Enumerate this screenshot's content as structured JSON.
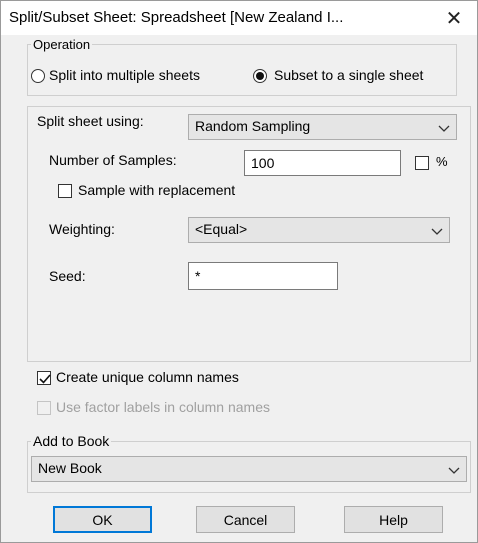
{
  "window": {
    "title": "Split/Subset Sheet: Spreadsheet [New Zealand I...",
    "close_symbol": "✕"
  },
  "operation": {
    "group_label": "Operation",
    "options": [
      {
        "label": "Split into multiple sheets",
        "selected": false
      },
      {
        "label": "Subset to a single sheet",
        "selected": true
      }
    ]
  },
  "split": {
    "label": "Split sheet using:",
    "selected": "Random Sampling",
    "samples_label": "Number of Samples:",
    "samples_value": "100",
    "percent_label": "%",
    "percent_checked": false,
    "replacement_label": "Sample with replacement",
    "replacement_checked": false,
    "weighting_label": "Weighting:",
    "weighting_value": "<Equal>",
    "seed_label": "Seed:",
    "seed_value": "*"
  },
  "options": {
    "unique_names_label": "Create unique column names",
    "unique_names_checked": true,
    "factor_labels_label": "Use factor labels in column names",
    "factor_labels_checked": false,
    "factor_labels_enabled": false
  },
  "add_to_book": {
    "label": "Add to Book",
    "value": "New Book"
  },
  "buttons": {
    "ok": "OK",
    "cancel": "Cancel",
    "help": "Help"
  },
  "icons": {
    "close": "close-icon",
    "dropdown": "chevron-down-icon",
    "check": "checkmark-icon"
  },
  "colors": {
    "accent": "#0078d7",
    "dialog_bg": "#f0f0f0",
    "disabled_text": "#a0a0a0"
  }
}
